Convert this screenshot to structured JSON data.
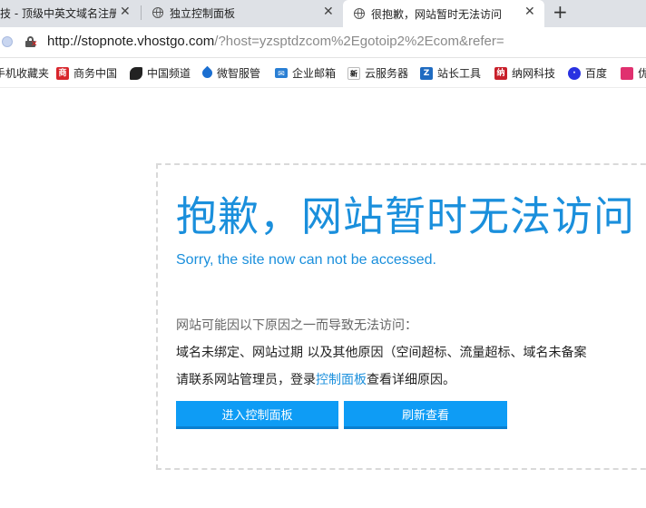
{
  "tabs": [
    {
      "title": "技 - 顶级中英文域名注册",
      "close": "✕",
      "active": false
    },
    {
      "title": "独立控制面板",
      "close": "✕",
      "active": false
    },
    {
      "title": "很抱歉，网站暂时无法访问",
      "close": "✕",
      "active": true
    }
  ],
  "new_tab": "+",
  "address": {
    "url_host": "http://stopnote.vhostgo.com",
    "url_rest": "/?host=yzsptdzcom%2Egotoip2%2Ecom&refer="
  },
  "bookmarks": [
    {
      "label": "手机收藏夹",
      "icon": "none"
    },
    {
      "label": "商务中国",
      "icon": "shangwu-icon",
      "color": "#d8252c"
    },
    {
      "label": "中国频道",
      "icon": "chinaface-icon",
      "color": "#222222"
    },
    {
      "label": "微智服管",
      "icon": "drop-icon",
      "color": "#1b6fd1"
    },
    {
      "label": "企业邮箱",
      "icon": "mail-icon",
      "color": "#2a7fd4"
    },
    {
      "label": "云服务器",
      "icon": "xinnet-icon",
      "color": "#111111"
    },
    {
      "label": "站长工具",
      "icon": "chinaz-icon",
      "color": "#1f6bc1"
    },
    {
      "label": "纳网科技",
      "icon": "naw-icon",
      "color": "#c8202b"
    },
    {
      "label": "百度",
      "icon": "baidu-paw-icon",
      "color": "#2932e1"
    },
    {
      "label": "优",
      "icon": "you-icon",
      "color": "#e0306f"
    }
  ],
  "main": {
    "headline": "抱歉，网站暂时无法访问",
    "subline": "Sorry, the site now can not be accessed.",
    "reason_intro": "网站可能因以下原因之一而导致无法访问：",
    "reason_detail": "域名未绑定、网站过期 以及其他原因（空间超标、流量超标、域名未备案",
    "contact_prefix": "请联系网站管理员，登录",
    "contact_link": "控制面板",
    "contact_suffix": "查看详细原因。",
    "button_panel": "进入控制面板",
    "button_refresh": "刷新查看"
  },
  "colors": {
    "accent": "#1a8fdc",
    "button": "#0e9cf5"
  }
}
